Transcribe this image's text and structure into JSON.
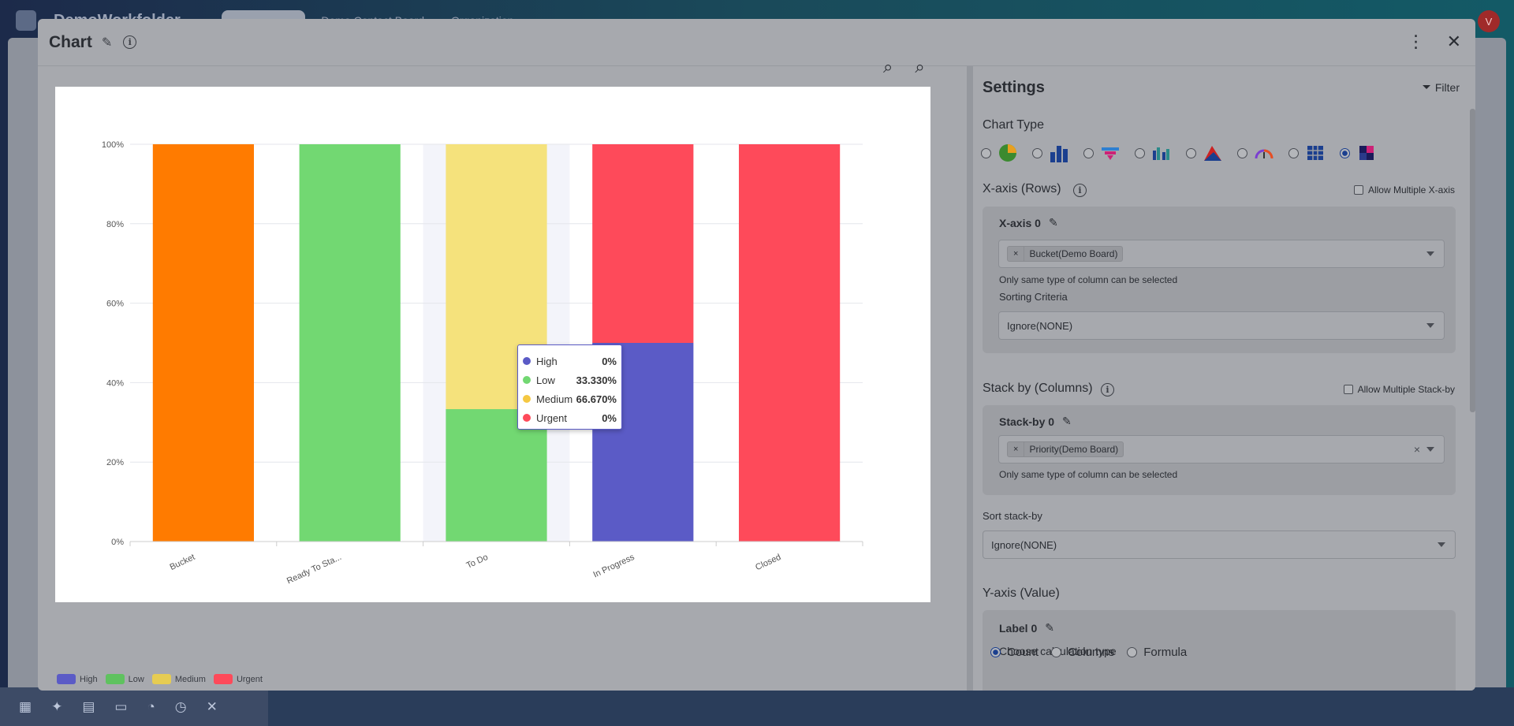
{
  "background": {
    "brand": "DemoWorkfolder",
    "tabs": [
      "Demo Board",
      "Demo Contact Board",
      "Organization"
    ],
    "avatar": "V"
  },
  "modal": {
    "title": "Chart",
    "more_icon": "more-vertical-icon",
    "close_icon": "close-icon"
  },
  "chart_data": {
    "type": "bar",
    "stacked": true,
    "percent_stacked": true,
    "categories": [
      "Bucket",
      "Ready To Sta...",
      "To Do",
      "In Progress",
      "Closed"
    ],
    "series": [
      {
        "name": "High",
        "color": "#5b5bc6",
        "values": [
          0,
          0,
          0,
          50,
          0
        ]
      },
      {
        "name": "Low",
        "color": "#72d872",
        "values": [
          0,
          100,
          33.33,
          0,
          0
        ]
      },
      {
        "name": "Medium",
        "color": "#f5e27c",
        "values": [
          0,
          0,
          66.67,
          0,
          0
        ]
      },
      {
        "name": "Urgent",
        "color": "#fe4a5a",
        "values": [
          0,
          0,
          0,
          50,
          100
        ]
      }
    ],
    "bucket_color": "#ff7b00",
    "y_ticks": [
      "0%",
      "20%",
      "40%",
      "60%",
      "80%",
      "100%"
    ],
    "ylim": [
      0,
      100
    ],
    "grid": true,
    "legend": "bottom-left",
    "highlighted_category": "To Do",
    "tooltip": {
      "rows": [
        {
          "name": "High",
          "value": "0%",
          "color": "#5b5bc6"
        },
        {
          "name": "Low",
          "value": "33.330%",
          "color": "#72d872"
        },
        {
          "name": "Medium",
          "value": "66.670%",
          "color": "#f5c842"
        },
        {
          "name": "Urgent",
          "value": "0%",
          "color": "#fe4a5a"
        }
      ]
    }
  },
  "legend": [
    {
      "name": "High",
      "color": "#5b5bc6"
    },
    {
      "name": "Low",
      "color": "#5fc25f"
    },
    {
      "name": "Medium",
      "color": "#e6cc52"
    },
    {
      "name": "Urgent",
      "color": "#fe4a5a"
    }
  ],
  "settings": {
    "title": "Settings",
    "filter_label": "Filter",
    "chart_type_label": "Chart Type",
    "chart_types": [
      "pie-chart-icon",
      "bar-chart-icon",
      "funnel-chart-icon",
      "grouped-bar-icon",
      "area-chart-icon",
      "gauge-chart-icon",
      "pivot-table-icon",
      "heatmap-icon"
    ],
    "selected_chart_type": 7,
    "x_axis": {
      "label": "X-axis (Rows)",
      "allow_multiple": "Allow Multiple X-axis",
      "item_title": "X-axis 0",
      "chip": "Bucket(Demo Board)",
      "hint": "Only same type of column can be selected",
      "sorting_label": "Sorting Criteria",
      "sorting_value": "Ignore(NONE)"
    },
    "stack_by": {
      "label": "Stack by (Columns)",
      "allow_multiple": "Allow Multiple Stack-by",
      "item_title": "Stack-by 0",
      "chip": "Priority(Demo Board)",
      "hint": "Only same type of column can be selected",
      "sort_label": "Sort stack-by",
      "sort_value": "Ignore(NONE)"
    },
    "y_axis": {
      "label": "Y-axis (Value)",
      "item_title": "Label 0",
      "calc_label": "Choose calculation type",
      "options": [
        "Count",
        "Columns",
        "Formula"
      ],
      "selected": "Count"
    }
  }
}
